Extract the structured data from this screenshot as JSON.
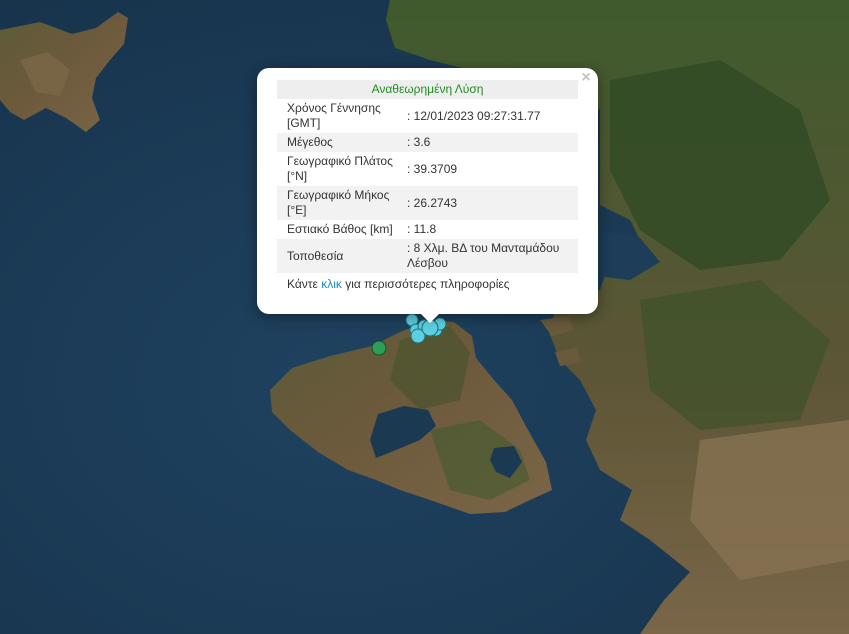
{
  "popup": {
    "close_icon": "×",
    "header": "Αναθεωρημένη Λύση",
    "rows": [
      {
        "label": "Χρόνος Γέννησης [GMT]",
        "value": ": 12/01/2023 09:27:31.77"
      },
      {
        "label": "Μέγεθος",
        "value": ": 3.6"
      },
      {
        "label": "Γεωγραφικό Πλάτος [°N]",
        "value": ": 39.3709"
      },
      {
        "label": "Γεωγραφικό Μήκος [°E]",
        "value": ": 26.2743"
      },
      {
        "label": "Εστιακό Βάθος [km]",
        "value": ": 11.8"
      },
      {
        "label": "Τοποθεσία",
        "value": ": 8 Χλμ. ΒΔ του Μανταμάδου Λέσβου"
      }
    ],
    "footer_before": "Κάντε ",
    "footer_link": "κλικ",
    "footer_after": " για περισσότερες πληροφορίες",
    "header_color": "#228b22",
    "link_color": "#1a8bbf"
  },
  "map": {
    "sea_color": "#1b3a52",
    "land_color": "#6b5a3c",
    "vegetation_color": "#3d5a2a",
    "markers": [
      {
        "type": "recent",
        "color": "#5cd0e0"
      },
      {
        "type": "older",
        "color": "#2e9e55"
      }
    ]
  }
}
